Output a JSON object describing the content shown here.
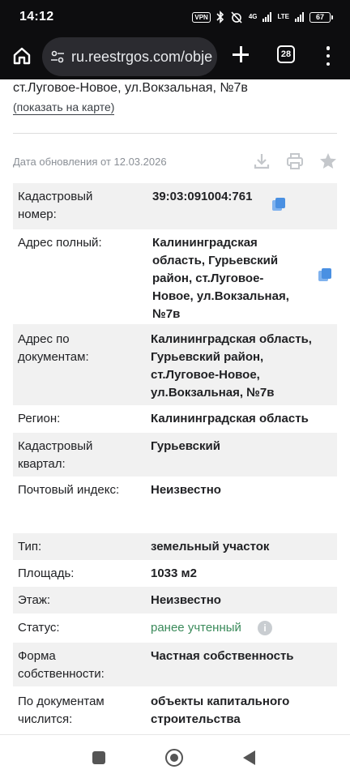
{
  "status_bar": {
    "time": "14:12",
    "vpn_label": "VPN",
    "network_label": "4G",
    "volte_label": "LTE",
    "battery": "67"
  },
  "browser": {
    "url": "ru.reestrgos.com/obje",
    "tab_count": "28"
  },
  "page": {
    "address_header": "ст.Луговое-Новое, ул.Вокзальная, №7в",
    "show_on_map": "(показать на карте)",
    "update_date": "Дата обновления от 12.03.2026"
  },
  "section1": [
    {
      "label": [
        "Кадастровый",
        "номер:"
      ],
      "value": [
        "39:03:091004:761"
      ],
      "bold": true,
      "copy": true
    },
    {
      "label": [
        "Адрес полный:"
      ],
      "value": [
        "Калининградская",
        "область, Гурьевский",
        "район, ст.Луговое-",
        "Новое, ул.Вокзальная,",
        "№7в"
      ],
      "bold": true,
      "copy": true
    },
    {
      "label": [
        "Адрес по",
        "документам:"
      ],
      "value": [
        "Калининградская область,",
        "Гурьевский район,",
        "ст.Луговое-Новое,",
        "ул.Вокзальная, №7в"
      ],
      "bold": true
    },
    {
      "label": [
        "Регион:"
      ],
      "value": [
        "Калининградская область"
      ],
      "bold": true
    },
    {
      "label": [
        "Кадастровый",
        "квартал:"
      ],
      "value": [
        "Гурьевский"
      ],
      "bold": true
    },
    {
      "label": [
        "Почтовый индекс:"
      ],
      "value": [
        "Неизвестно"
      ],
      "bold": true
    }
  ],
  "section2": [
    {
      "label": [
        "Тип:"
      ],
      "value": [
        "земельный участок"
      ],
      "bold": true
    },
    {
      "label": [
        "Площадь:"
      ],
      "value": [
        "1033 м2"
      ],
      "bold": true
    },
    {
      "label": [
        "Этаж:"
      ],
      "value": [
        "Неизвестно"
      ],
      "bold": true
    },
    {
      "label": [
        "Статус:"
      ],
      "value": [
        "ранее учтенный"
      ],
      "status": true
    },
    {
      "label": [
        "Форма",
        "собственности:"
      ],
      "value": [
        "Частная собственность"
      ],
      "bold": true
    },
    {
      "label": [
        "По документам",
        "числится:"
      ],
      "value": [
        "объекты капитального",
        "строительства"
      ],
      "bold": true
    }
  ],
  "colors": {
    "status_green": "#3a8a5a",
    "copy_blue": "#4a90e2",
    "row_shade": "#f1f1f1"
  },
  "icons": [
    "home-icon",
    "tune-icon",
    "plus-icon",
    "tabs-icon",
    "overflow-menu-icon",
    "download-icon",
    "print-icon",
    "star-icon",
    "copy-icon",
    "info-icon"
  ]
}
